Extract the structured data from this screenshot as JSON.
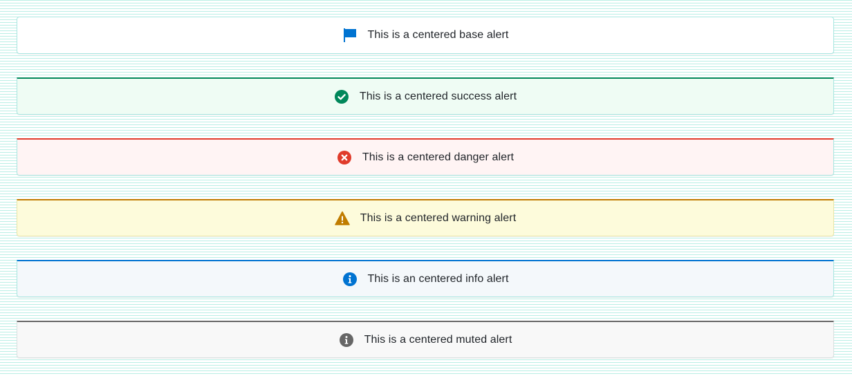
{
  "alerts": {
    "base": {
      "text": "This is a centered base alert",
      "icon": "flag-icon",
      "color": "#0073d1",
      "background": "#ffffff"
    },
    "success": {
      "text": "This is a centered success alert",
      "icon": "check-circle-icon",
      "color": "#00875a",
      "background": "#effcf4"
    },
    "danger": {
      "text": "This is a centered danger alert",
      "icon": "x-circle-icon",
      "color": "#e03b2b",
      "background": "#fff4f4"
    },
    "warning": {
      "text": "This is a centered warning alert",
      "icon": "warning-triangle-icon",
      "color": "#c07c00",
      "background": "#fdfbdb"
    },
    "info": {
      "text": "This is an centered info alert",
      "icon": "info-circle-icon",
      "color": "#0073d1",
      "background": "#f4f8fb"
    },
    "muted": {
      "text": "This is a centered muted alert",
      "icon": "info-circle-icon",
      "color": "#666666",
      "background": "#f8f8f8"
    }
  }
}
